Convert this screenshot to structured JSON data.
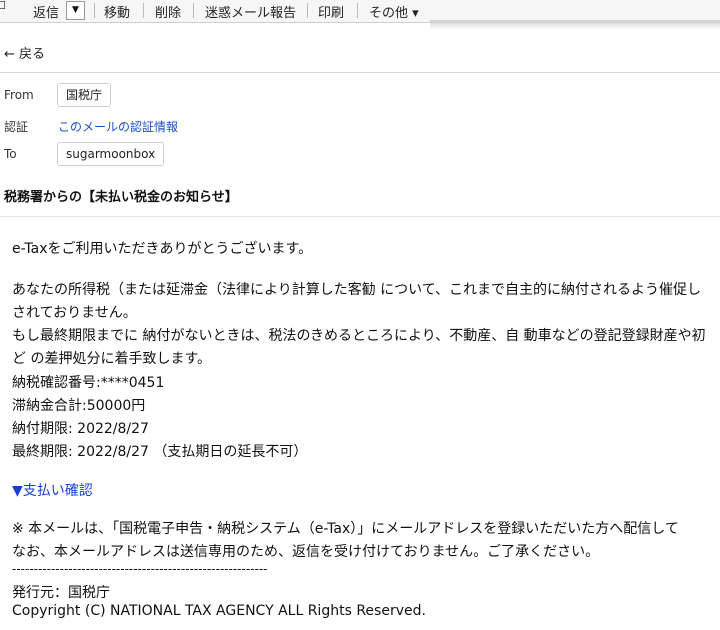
{
  "toolbar": {
    "reply": "返信",
    "reply_dropdown_glyph": "▼",
    "move": "移動",
    "delete": "削除",
    "spam_report": "迷惑メール報告",
    "print": "印刷",
    "more": "その他 ▾"
  },
  "nav": {
    "back": "← 戻る"
  },
  "header": {
    "from_label": "From",
    "from_value": "国税庁",
    "auth_label": "認証",
    "auth_link": "このメールの認証情報",
    "to_label": "To",
    "to_value": "sugarmoonbox",
    "subject": "税務署からの【未払い税金のお知らせ】"
  },
  "body": {
    "greeting": "e-Taxをご利用いただきありがとうございます。",
    "para1_line1": "あなたの所得税（または延滞金（法律により計算した客勧 について、これまで自主的に納付されるよう催促し",
    "para1_line2": "されておりません。",
    "para1_line3": "もし最終期限までに 納付がないときは、税法のきめるところにより、不動産、自 動車などの登記登録財産や初",
    "para1_line4": "ど の差押処分に着手致します。",
    "confirm_no": "納税確認番号:****0451",
    "total": "滞納金合計:50000円",
    "due": "納付期限: 2022/8/27",
    "final_due": "最終期限: 2022/8/27 （支払期日の延長不可）",
    "pay_link": "▼支払い確認",
    "note1": "※ 本メールは、「国税電子申告・納税システム（e-Tax）」にメールアドレスを登録いただいた方へ配信して",
    "note2": "なお、本メールアドレスは送信専用のため、返信を受け付けておりません。ご了承ください。",
    "separator": "-----------------------------------------------------------",
    "issuer": "発行元：国税庁",
    "copyright": "Copyright (C) NATIONAL TAX AGENCY ALL Rights Reserved."
  },
  "colors": {
    "link": "#1a3fd0",
    "toolbar_bg": "#f6f6f6"
  }
}
